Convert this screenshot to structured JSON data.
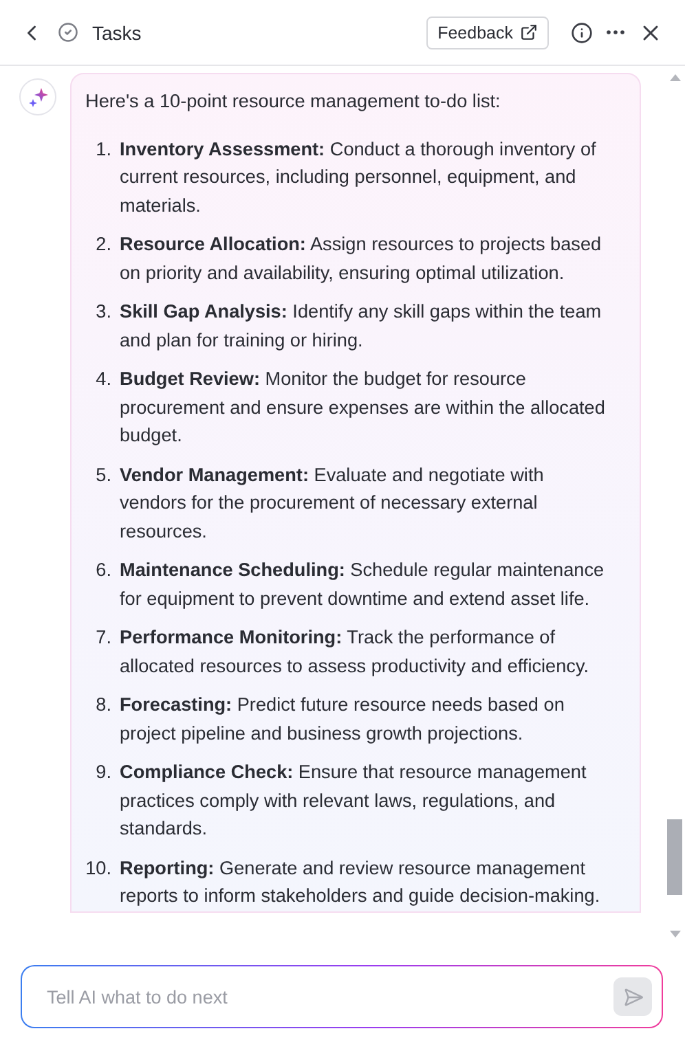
{
  "header": {
    "title": "Tasks",
    "feedback": "Feedback"
  },
  "message": {
    "intro": "Here's a 10-point resource management to-do list:",
    "items": [
      {
        "number": "1.",
        "text": "**Inventory Assessment:** Conduct a thorough inventory of current resources, including personnel, equipment, and materials."
      },
      {
        "number": "2.",
        "text": "**Resource Allocation:** Assign resources to projects based on priority and availability, ensuring optimal utilization."
      },
      {
        "number": "3.",
        "text": "**Skill Gap Analysis:** Identify any skill gaps within the team and plan for training or hiring."
      },
      {
        "number": "4.",
        "text": "**Budget Review:** Monitor the budget for resource procurement and ensure expenses are within the allocated budget."
      },
      {
        "number": "5.",
        "text": "**Vendor Management:** Evaluate and negotiate with vendors for the procurement of necessary external resources."
      },
      {
        "number": "6.",
        "text": "**Maintenance Scheduling:** Schedule regular maintenance for equipment to prevent downtime and extend asset life."
      },
      {
        "number": "7.",
        "text": "**Performance Monitoring:** Track the performance of allocated resources to assess productivity and efficiency."
      },
      {
        "number": "8.",
        "text": "**Forecasting:** Predict future resource needs based on project pipeline and business growth projections."
      },
      {
        "number": "9.",
        "text": "**Compliance Check:** Ensure that resource management practices comply with relevant laws, regulations, and standards."
      },
      {
        "number": "10.",
        "text": "**Reporting:** Generate and review resource management reports to inform stakeholders and guide decision-making."
      }
    ]
  },
  "input": {
    "placeholder": "Tell AI what to do next"
  }
}
